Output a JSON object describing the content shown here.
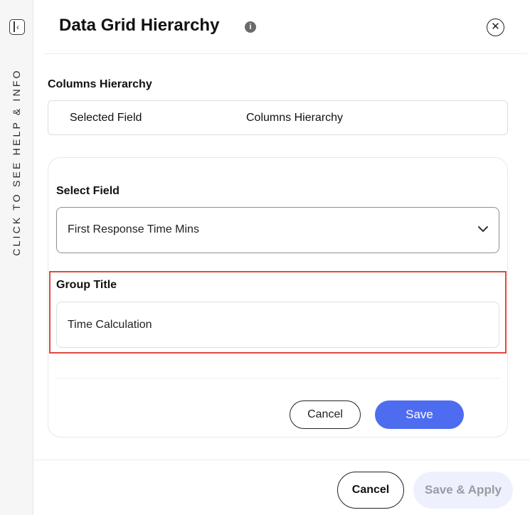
{
  "side_rail": {
    "help_text": "CLICK TO SEE HELP & INFO",
    "toggle_icon": "panel-toggle-icon"
  },
  "header": {
    "title": "Data Grid Hierarchy",
    "info_icon": "info-icon",
    "close_icon": "close-icon"
  },
  "columns_hierarchy": {
    "label": "Columns Hierarchy",
    "headers": [
      "Selected Field",
      "Columns Hierarchy"
    ]
  },
  "editor": {
    "select_field_label": "Select Field",
    "select_field_value": "First Response Time Mins",
    "group_title_label": "Group Title",
    "group_title_value": "Time Calculation",
    "cancel_label": "Cancel",
    "save_label": "Save",
    "highlight_color": "#e04a3f",
    "accent_color": "#4e6cf0"
  },
  "footer": {
    "cancel_label": "Cancel",
    "save_apply_label": "Save & Apply"
  }
}
